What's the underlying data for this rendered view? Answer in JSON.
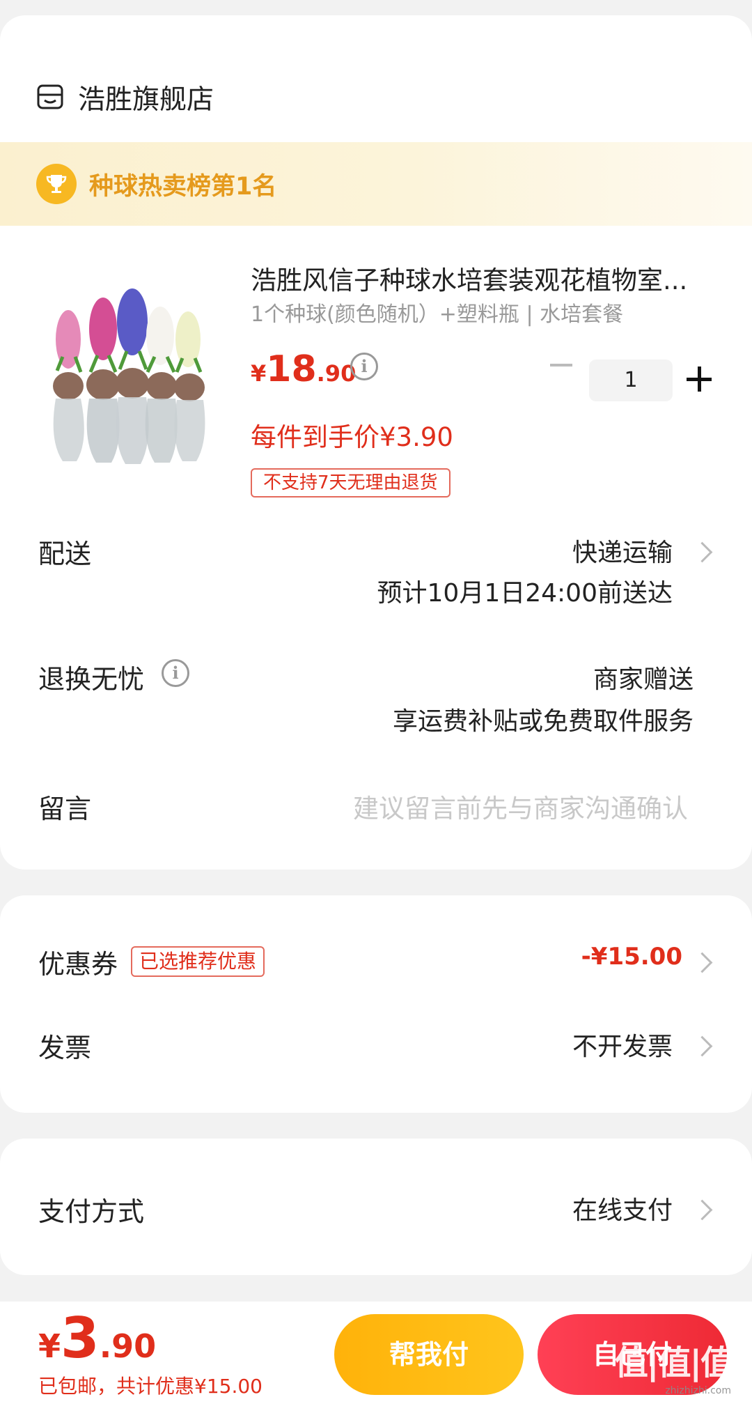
{
  "store": {
    "name": "浩胜旗舰店",
    "icon": "store-icon"
  },
  "rank_banner": {
    "text": "种球热卖榜第1名",
    "icon": "trophy-icon"
  },
  "product": {
    "title": "浩胜风信子种球水培套装观花植物室...",
    "sku": "1个种球(颜色随机）+塑料瓶 | 水培套餐",
    "price_symbol": "¥",
    "price_int": "18",
    "price_dec": ".90",
    "quantity": "1",
    "unit_price": "每件到手价¥3.90",
    "return_policy": "不支持7天无理由退货"
  },
  "delivery": {
    "label": "配送",
    "method": "快递运输",
    "eta": "预计10月1日24:00前送达"
  },
  "returns": {
    "label": "退换无忧",
    "value": "商家赠送",
    "detail": "享运费补贴或免费取件服务"
  },
  "message": {
    "label": "留言",
    "placeholder": "建议留言前先与商家沟通确认"
  },
  "coupon": {
    "label": "优惠券",
    "tag": "已选推荐优惠",
    "discount": "-¥15.00"
  },
  "invoice": {
    "label": "发票",
    "value": "不开发票"
  },
  "payment": {
    "label": "支付方式",
    "value": "在线支付"
  },
  "bottom": {
    "price_symbol": "¥",
    "price_int": "3",
    "price_dec": ".90",
    "summary": "已包邮，共计优惠¥15.00",
    "help_pay_label": "帮我付",
    "self_pay_label": "自己付",
    "watermark": "值|值|值",
    "watermark_sub": "zhizhizhi.com"
  },
  "colors": {
    "accent_red": "#e02e1b",
    "gold": "#f7b822",
    "pay_red": "#ee2a35",
    "help_orange": "#ffb20a"
  }
}
